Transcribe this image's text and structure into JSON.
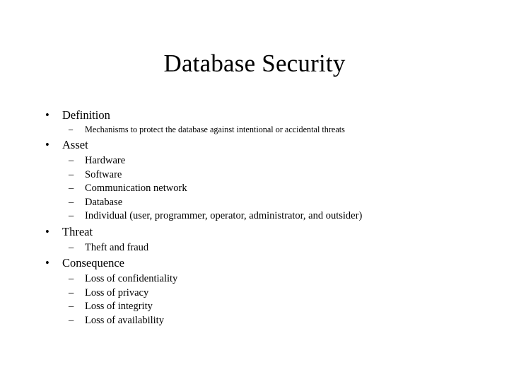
{
  "slide": {
    "title": "Database Security",
    "background_color": "#ffffff",
    "text_color": "#000000",
    "bullet_marker_level1": "•",
    "bullet_marker_level2": "–",
    "outline": [
      {
        "label": "Definition",
        "children": [
          {
            "label": "Mechanisms to protect the database against intentional or accidental threats"
          }
        ]
      },
      {
        "label": "Asset",
        "children": [
          {
            "label": "Hardware"
          },
          {
            "label": "Software"
          },
          {
            "label": "Communication network"
          },
          {
            "label": "Database"
          },
          {
            "label": "Individual (user, programmer, operator, administrator,  and outsider)"
          }
        ]
      },
      {
        "label": "Threat",
        "children": [
          {
            "label": "Theft and fraud"
          }
        ]
      },
      {
        "label": "Consequence",
        "children": [
          {
            "label": "Loss of confidentiality"
          },
          {
            "label": "Loss of privacy"
          },
          {
            "label": "Loss of integrity"
          },
          {
            "label": "Loss of availability"
          }
        ]
      }
    ]
  }
}
